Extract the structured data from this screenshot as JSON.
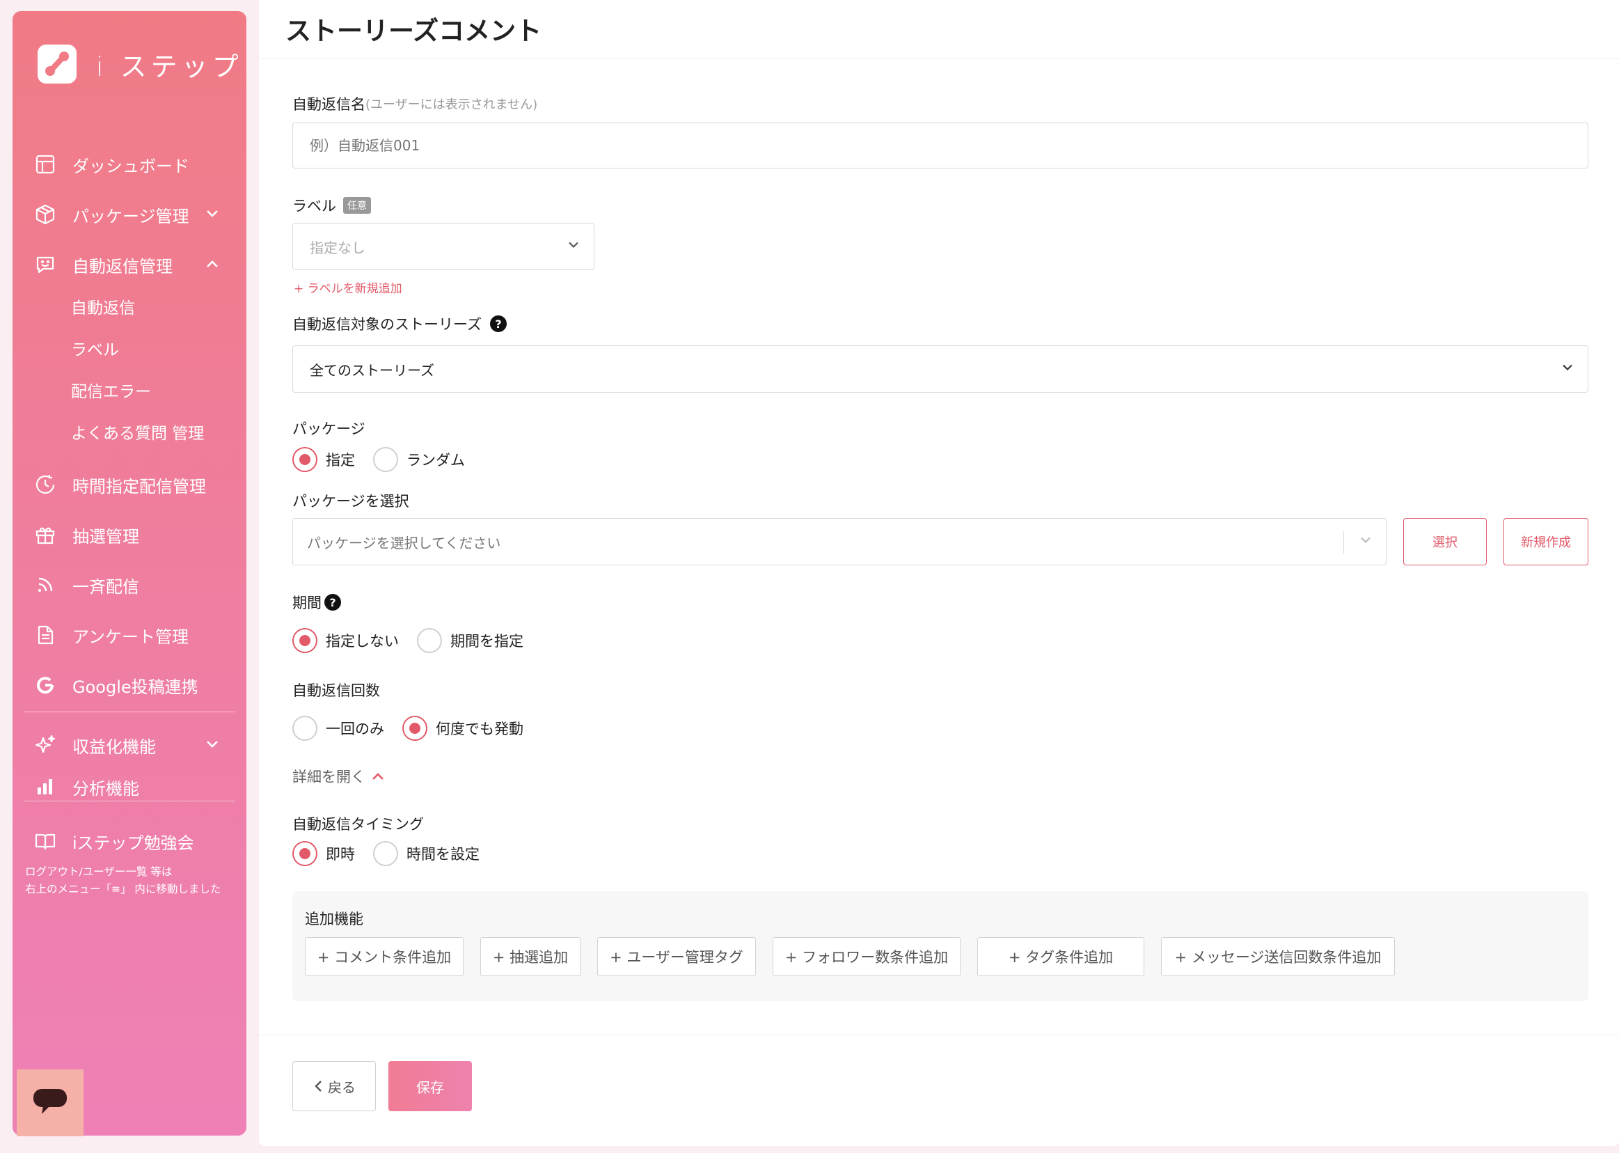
{
  "app": {
    "name": "i ステップ"
  },
  "sidebar": {
    "items": [
      {
        "label": "ダッシュボード"
      },
      {
        "label": "パッケージ管理"
      },
      {
        "label": "自動返信管理"
      },
      {
        "label": "時間指定配信管理"
      },
      {
        "label": "抽選管理"
      },
      {
        "label": "一斉配信"
      },
      {
        "label": "アンケート管理"
      },
      {
        "label": "Google投稿連携"
      },
      {
        "label": "収益化機能"
      },
      {
        "label": "分析機能"
      },
      {
        "label": "iステップ勉強会"
      }
    ],
    "sub_items": [
      {
        "label": "自動返信"
      },
      {
        "label": "ラベル"
      },
      {
        "label": "配信エラー"
      },
      {
        "label": "よくある質問 管理"
      }
    ],
    "note_line1": "ログアウト/ユーザー一覧 等は",
    "note_line2": "右上のメニュー「≡」 内に移動しました"
  },
  "page": {
    "title": "ストーリーズコメント"
  },
  "form": {
    "name_label": "自動返信名",
    "name_hint": "(ユーザーには表示されません)",
    "name_placeholder": "例）自動返信001",
    "label_label": "ラベル",
    "label_badge": "任意",
    "label_selected": "指定なし",
    "label_add": "+ ラベルを新規追加",
    "stories_label": "自動返信対象のストーリーズ",
    "stories_selected": "全てのストーリーズ",
    "package_label": "パッケージ",
    "package_opt1": "指定",
    "package_opt2": "ランダム",
    "package_select_label": "パッケージを選択",
    "package_select_placeholder": "パッケージを選択してください",
    "select_button": "選択",
    "new_button": "新規作成",
    "period_label": "期間",
    "period_opt1": "指定しない",
    "period_opt2": "期間を指定",
    "count_label": "自動返信回数",
    "count_opt1": "一回のみ",
    "count_opt2": "何度でも発動",
    "details_link": "詳細を開く",
    "timing_label": "自動返信タイミング",
    "timing_opt1": "即時",
    "timing_opt2": "時間を設定",
    "addon_title": "追加機能",
    "addons": [
      "+ コメント条件追加",
      "+ 抽選追加",
      "+ ユーザー管理タグ",
      "+ フォロワー数条件追加",
      "+ タグ条件追加",
      "+ メッセージ送信回数条件追加"
    ],
    "back_button": "戻る",
    "save_button": "保存"
  },
  "colors": {
    "accent": "#e25a69",
    "sidebar_top": "#f07b85",
    "sidebar_bottom": "#ee80b6"
  }
}
